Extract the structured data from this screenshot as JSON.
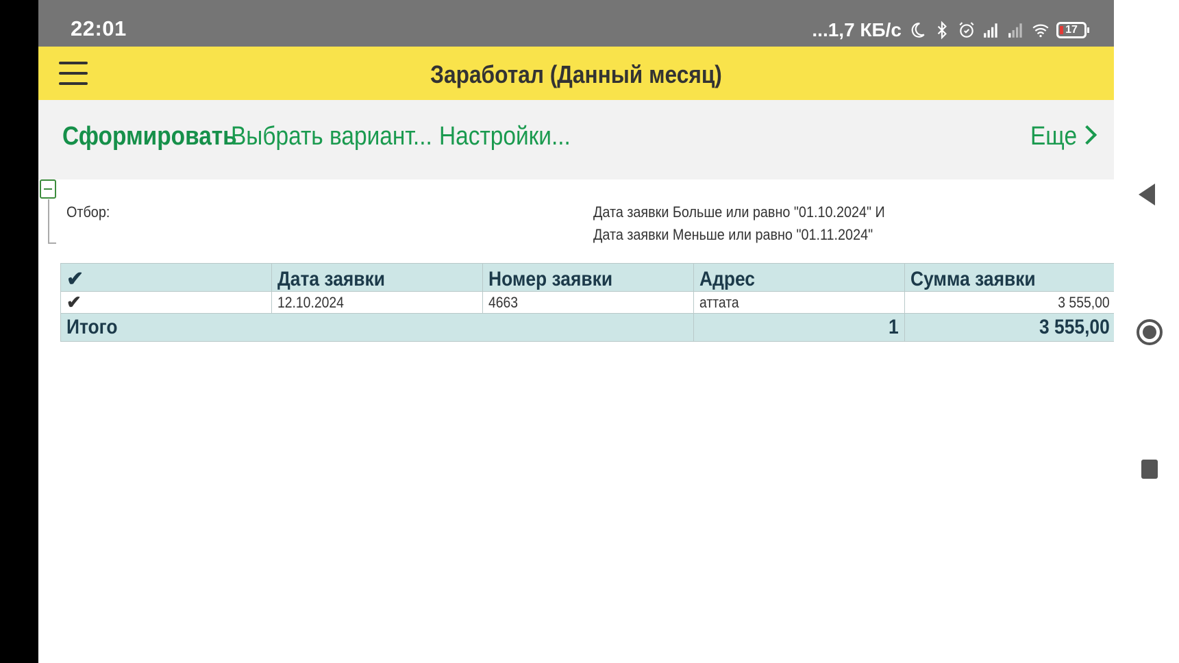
{
  "status_bar": {
    "time": "22:01",
    "network_speed": "...1,7 КБ/с",
    "battery_level": "17",
    "icons": [
      "moon-icon",
      "bluetooth-icon",
      "alarm-icon",
      "signal-icon",
      "signal-weak-icon",
      "wifi-icon",
      "battery-icon"
    ]
  },
  "header": {
    "title": "Заработал (Данный месяц)",
    "background_color": "#f9e34b"
  },
  "commands": {
    "form": "Сформировать",
    "choose_variant": "Выбрать вариант...",
    "settings": "Настройки...",
    "more": "Еще",
    "accent_color": "#1a9a4f"
  },
  "filter": {
    "label": "Отбор:",
    "line1": "Дата заявки Больше или равно \"01.10.2024\" И",
    "line2": "Дата заявки Меньше или равно \"01.11.2024\""
  },
  "table": {
    "header_check": "✔",
    "columns": [
      "Дата заявки",
      "Номер заявки",
      "Адрес",
      "Сумма заявки"
    ],
    "rows": [
      {
        "check": "✔",
        "date": "12.10.2024",
        "number": "4663",
        "address": "аттата",
        "sum": "3 555,00"
      }
    ],
    "total": {
      "label": "Итого",
      "count": "1",
      "sum": "3 555,00"
    },
    "header_color": "#cde6e6"
  },
  "nav_bar": {
    "icons": [
      "back-icon",
      "home-icon",
      "recents-icon"
    ]
  }
}
